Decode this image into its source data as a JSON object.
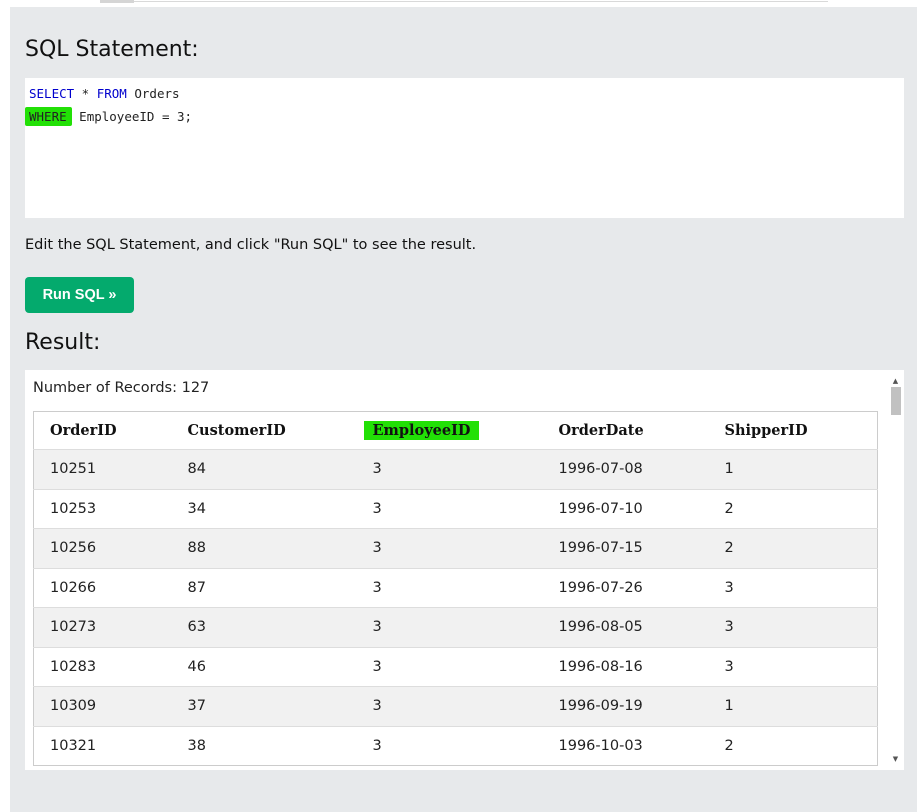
{
  "sql": {
    "heading": "SQL Statement:",
    "line1": {
      "kw1": "SELECT",
      "mid": " * ",
      "kw2": "FROM",
      "rest": " Orders"
    },
    "line2": {
      "kw": "WHERE",
      "rest": " EmployeeID = 3;"
    },
    "highlight_color": "#22e006",
    "keyword_color": "#0000cd"
  },
  "instructions": "Edit the SQL Statement, and click \"Run SQL\" to see the result.",
  "run_button": {
    "label": "Run SQL »",
    "color": "#04aa6d"
  },
  "result": {
    "heading": "Result:",
    "records_label": "Number of Records: 127",
    "columns": [
      "OrderID",
      "CustomerID",
      "EmployeeID",
      "OrderDate",
      "ShipperID"
    ],
    "rows": [
      [
        "10251",
        "84",
        "3",
        "1996-07-08",
        "1"
      ],
      [
        "10253",
        "34",
        "3",
        "1996-07-10",
        "2"
      ],
      [
        "10256",
        "88",
        "3",
        "1996-07-15",
        "2"
      ],
      [
        "10266",
        "87",
        "3",
        "1996-07-26",
        "3"
      ],
      [
        "10273",
        "63",
        "3",
        "1996-08-05",
        "3"
      ],
      [
        "10283",
        "46",
        "3",
        "1996-08-16",
        "3"
      ],
      [
        "10309",
        "37",
        "3",
        "1996-09-19",
        "1"
      ],
      [
        "10321",
        "38",
        "3",
        "1996-10-03",
        "2"
      ]
    ]
  },
  "icons": {
    "scroll_up": "▲",
    "scroll_down": "▼"
  }
}
